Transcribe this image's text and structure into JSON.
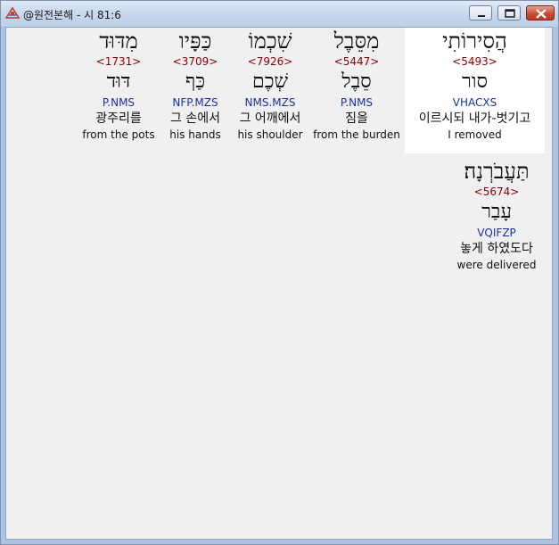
{
  "window": {
    "title": "@원전본해 - 시 81:6",
    "app_icon": "bible-app-icon",
    "controls": [
      "minimize-icon",
      "maximize-icon",
      "close-icon"
    ]
  },
  "words": [
    {
      "hebrew": "הֲסִירוֹתִי",
      "strong": "<5493>",
      "lemma": "סור",
      "parsing": "VHACXS",
      "korean": "이르시되 내가-벗기고",
      "english": "I removed",
      "selected": true
    },
    {
      "hebrew": "מִסֵּבֶל",
      "strong": "<5447>",
      "lemma": "סֵבֶל",
      "parsing": "P.NMS",
      "korean": "짐을",
      "english": "from the burden"
    },
    {
      "hebrew": "שִׁכְמוֹ",
      "strong": "<7926>",
      "lemma": "שְׁכֶם",
      "parsing": "NMS.MZS",
      "korean": "그 어깨에서",
      "english": "his shoulder"
    },
    {
      "hebrew": "כַּפָּיו",
      "strong": "<3709>",
      "lemma": "כַּף",
      "parsing": "NFP.MZS",
      "korean": "그 손에서",
      "english": "his hands"
    },
    {
      "hebrew": "מִדּוּד",
      "strong": "<1731>",
      "lemma": "דּוּד",
      "parsing": "P.NMS",
      "korean": "광주리를",
      "english": "from the pots"
    },
    {
      "hebrew": "תַּעֲבֹרְנָה׃",
      "strong": "<5674>",
      "lemma": "עָבַר",
      "parsing": "VQIFZP",
      "korean": "놓게 하였도다",
      "english": "were delivered"
    }
  ],
  "colors": {
    "strong": "#8b0000",
    "parsing": "#1c2fa8",
    "content_bg": "#f0f0f0",
    "selected_bg": "#ffffff"
  }
}
